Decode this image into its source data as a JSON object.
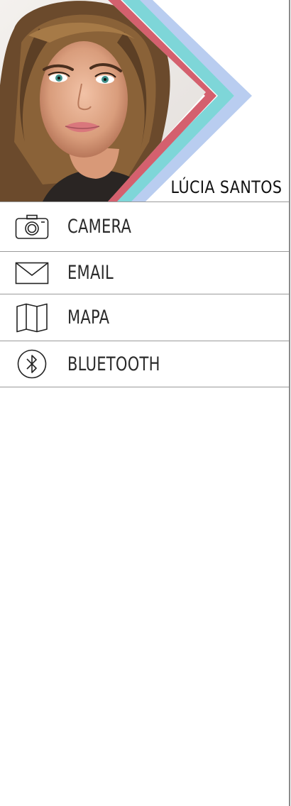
{
  "profile": {
    "name": "LÚCIA SANTOS",
    "stripe_colors": [
      "#4ecdc4",
      "#d4606e",
      "#7ed6d8",
      "#b9cdf0"
    ]
  },
  "menu": {
    "items": [
      {
        "label": "CAMERA",
        "icon": "camera-icon"
      },
      {
        "label": "EMAIL",
        "icon": "envelope-icon"
      },
      {
        "label": "MAPA",
        "icon": "map-icon"
      },
      {
        "label": "BLUETOOTH",
        "icon": "bluetooth-icon"
      }
    ]
  }
}
